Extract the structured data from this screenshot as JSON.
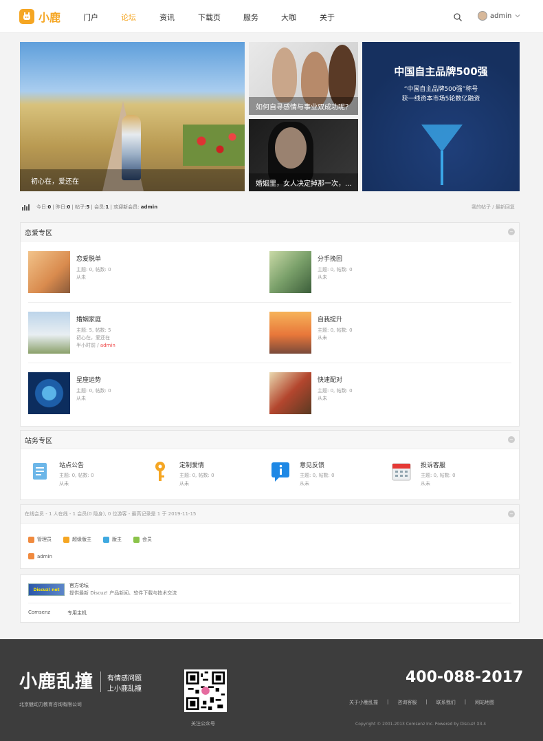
{
  "header": {
    "logo_text": "小鹿",
    "nav": [
      "门户",
      "论坛",
      "资讯",
      "下载页",
      "服务",
      "大咖",
      "关于"
    ],
    "active_nav": "论坛",
    "user_name": "admin"
  },
  "banners": {
    "b1_caption": "初心在，爱还在",
    "b2_caption": "如何自寻感情与事业双成功呢？",
    "b3_caption": "婚姻里，女人决定掉那一次，...",
    "b4_title": "中国自主品牌500强",
    "b4_sub1": "“中国自主品牌500强”称号",
    "b4_sub2": "获一线资本市场5轮数亿融资"
  },
  "stats": {
    "today_label": "今日:",
    "today": "0",
    "yesterday_label": "昨日:",
    "yesterday": "0",
    "posts_label": "帖子:",
    "posts": "5",
    "members_label": "会员:",
    "members": "1",
    "welcome_label": "欢迎新会员:",
    "new_member": "admin",
    "link_my": "我的帖子",
    "link_sep": "/",
    "link_latest": "最新回复"
  },
  "love_section": {
    "title": "恋爱专区",
    "forums": [
      {
        "name": "恋爱脱单",
        "stat": "主题: 0, 帖数: 0",
        "last": "从未"
      },
      {
        "name": "分手挽回",
        "stat": "主题: 0, 帖数: 0",
        "last": "从未"
      },
      {
        "name": "婚姻家庭",
        "stat": "主题: 5, 帖数: 5",
        "last": "初心在，爱还在",
        "last_time": "半小时前 /",
        "last_user": "admin"
      },
      {
        "name": "自我提升",
        "stat": "主题: 0, 帖数: 0",
        "last": "从未"
      },
      {
        "name": "星座运势",
        "stat": "主题: 0, 帖数: 0",
        "last": "从未"
      },
      {
        "name": "快速配对",
        "stat": "主题: 0, 帖数: 0",
        "last": "从未"
      }
    ]
  },
  "site_section": {
    "title": "站务专区",
    "forums": [
      {
        "name": "站点公告",
        "stat": "主题: 0, 帖数: 0",
        "last": "从未"
      },
      {
        "name": "定制爱情",
        "stat": "主题: 0, 帖数: 0",
        "last": "从未"
      },
      {
        "name": "意见反馈",
        "stat": "主题: 0, 帖数: 0",
        "last": "从未"
      },
      {
        "name": "投诉客服",
        "stat": "主题: 0, 帖数: 0",
        "last": "从未"
      }
    ]
  },
  "online": {
    "title": "在线会员 - 1 人在线 - 1 会员(0 隐身), 0 位游客 - 最高记录是 1 于 2019-11-15",
    "legend": [
      "管理员",
      "超级版主",
      "版主",
      "会员"
    ],
    "legend_colors": [
      "#f08a3e",
      "#f5a623",
      "#3fa9e0",
      "#8bc34a"
    ],
    "users": [
      "admin"
    ]
  },
  "links": {
    "logo_text": "Discuz! net",
    "name": "官方论坛",
    "desc": "提供最新 Discuz! 产品新闻、软件下载与技术交流",
    "text_links": [
      "Comsenz",
      "专用主机"
    ]
  },
  "footer": {
    "brand": "小鹿乱撞",
    "slogan1": "有情感问题",
    "slogan2": "上小鹿乱撞",
    "company": "北京魅动力教育咨询有限公司",
    "qr_label": "关注公众号",
    "phone": "400-088-2017",
    "links": [
      "关于小鹿乱撞",
      "|",
      "咨询客服",
      "|",
      "联系我们",
      "|",
      "网站地图"
    ],
    "copyright": "Copyright © 2001-2013 Comsenz Inc. Powered by Discuz! X3.4"
  }
}
